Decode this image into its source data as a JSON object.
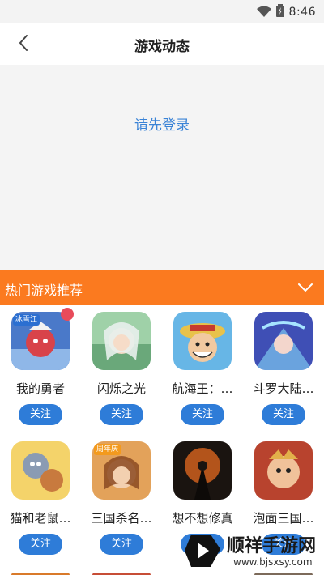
{
  "status_bar": {
    "time": "8:46"
  },
  "header": {
    "title": "游戏动态"
  },
  "login": {
    "prompt": "请先登录"
  },
  "recommend": {
    "title": "热门游戏推荐",
    "follow_label": "关注",
    "games": [
      {
        "name": "我的勇者",
        "tag": "冰雪江"
      },
      {
        "name": "闪烁之光",
        "tag": ""
      },
      {
        "name": "航海王：…",
        "tag": ""
      },
      {
        "name": "斗罗大陆…",
        "tag": ""
      },
      {
        "name": "猫和老鼠…",
        "tag": ""
      },
      {
        "name": "三国杀名…",
        "tag": "周年庆"
      },
      {
        "name": "想不想修真",
        "tag": ""
      },
      {
        "name": "泡面三国…",
        "tag": ""
      }
    ]
  },
  "watermark": {
    "title": "顺祥手游网",
    "url": "www.bjsxsy.com"
  },
  "colors": {
    "accent": "#fb7a1f",
    "follow": "#2e7cd8",
    "link": "#3a83d6"
  }
}
